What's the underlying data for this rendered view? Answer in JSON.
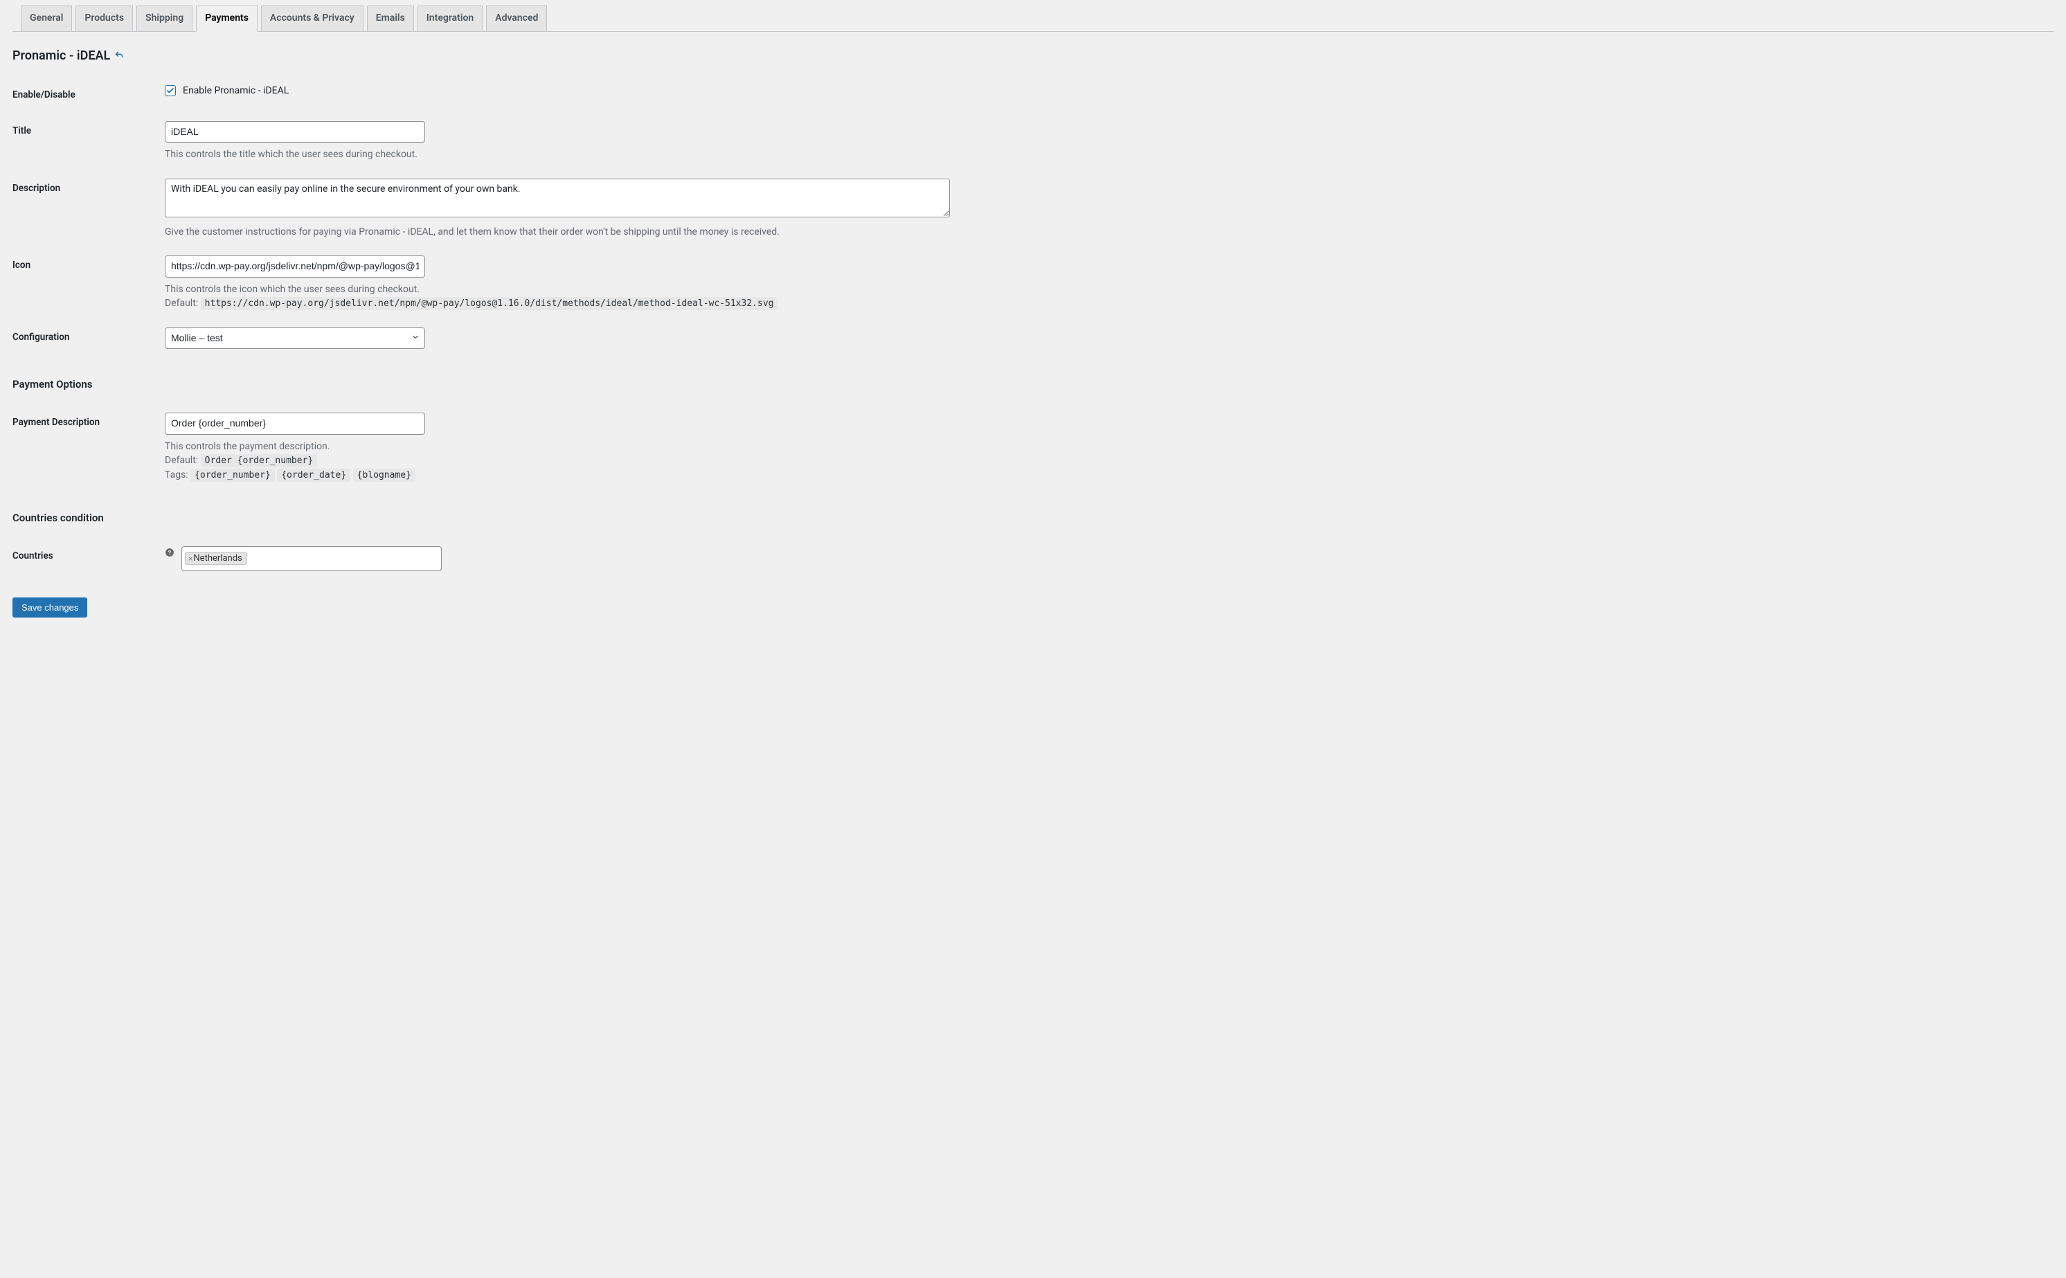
{
  "tabs": {
    "items": [
      {
        "label": "General",
        "active": false
      },
      {
        "label": "Products",
        "active": false
      },
      {
        "label": "Shipping",
        "active": false
      },
      {
        "label": "Payments",
        "active": true
      },
      {
        "label": "Accounts & Privacy",
        "active": false
      },
      {
        "label": "Emails",
        "active": false
      },
      {
        "label": "Integration",
        "active": false
      },
      {
        "label": "Advanced",
        "active": false
      }
    ]
  },
  "page": {
    "title": "Pronamic - iDEAL"
  },
  "enable": {
    "label": "Enable/Disable",
    "checkbox_label": "Enable Pronamic - iDEAL",
    "checked": true
  },
  "title_field": {
    "label": "Title",
    "value": "iDEAL",
    "help": "This controls the title which the user sees during checkout."
  },
  "description_field": {
    "label": "Description",
    "value": "With iDEAL you can easily pay online in the secure environment of your own bank.",
    "help": "Give the customer instructions for paying via Pronamic - iDEAL, and let them know that their order won't be shipping until the money is received."
  },
  "icon_field": {
    "label": "Icon",
    "value": "https://cdn.wp-pay.org/jsdelivr.net/npm/@wp-pay/logos@1.16.0/dist/methods/ideal/method-ideal-wc-51x32.svg",
    "help_line1": "This controls the icon which the user sees during checkout.",
    "help_default_label": "Default:",
    "help_default_code": "https://cdn.wp-pay.org/jsdelivr.net/npm/@wp-pay/logos@1.16.0/dist/methods/ideal/method-ideal-wc-51x32.svg"
  },
  "configuration_field": {
    "label": "Configuration",
    "selected": "Mollie – test"
  },
  "payment_options": {
    "heading": "Payment Options"
  },
  "payment_description_field": {
    "label": "Payment Description",
    "value": "Order {order_number}",
    "help_line1": "This controls the payment description.",
    "help_default_label": "Default:",
    "help_default_code": "Order {order_number}",
    "help_tags_label": "Tags:",
    "tags": [
      "{order_number}",
      "{order_date}",
      "{blogname}"
    ]
  },
  "countries_condition": {
    "heading": "Countries condition"
  },
  "countries_field": {
    "label": "Countries",
    "selected": [
      "Netherlands"
    ]
  },
  "submit": {
    "label": "Save changes"
  }
}
